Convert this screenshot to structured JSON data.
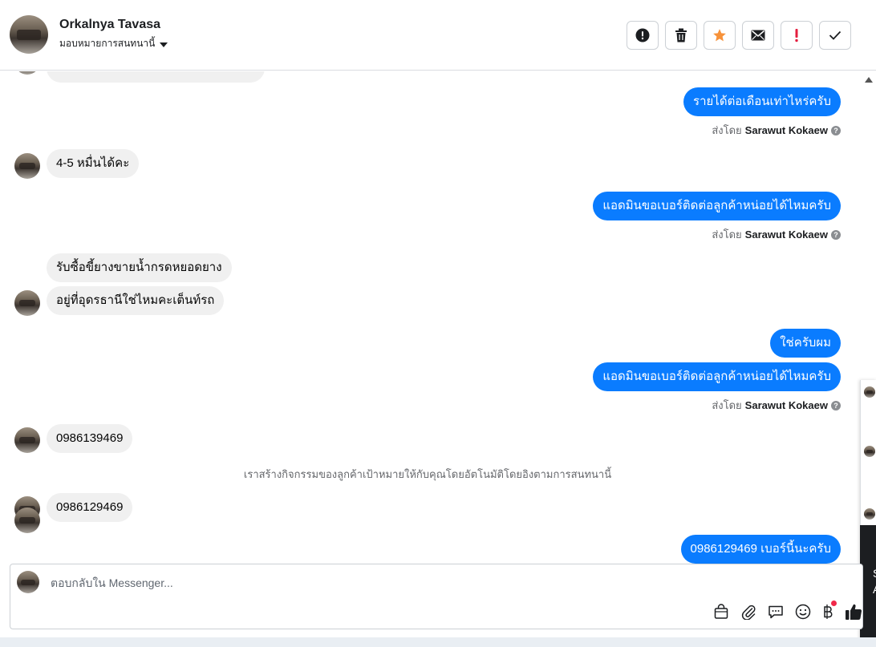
{
  "header": {
    "contact_name": "Orkalnya Tavasa",
    "assign_label": "มอบหมายการสนทนานี้"
  },
  "toolbar": {
    "buttons": [
      {
        "name": "report",
        "icon": "exclamation-circle-icon"
      },
      {
        "name": "delete",
        "icon": "trash-icon"
      },
      {
        "name": "star",
        "icon": "star-icon",
        "color": "#f7923a"
      },
      {
        "name": "mark-unread",
        "icon": "envelope-icon"
      },
      {
        "name": "mark-spam",
        "icon": "exclamation-icon",
        "color": "#e41e3f"
      },
      {
        "name": "mark-done",
        "icon": "checkmark-icon"
      }
    ]
  },
  "messages": {
    "m1": "รายได้ต่อเดือนเท่าไหร่ครับ",
    "m2": "4-5 หมื่นได้คะ",
    "m3": "แอดมินขอเบอร์ติดต่อลูกค้าหน่อยได้ไหมครับ",
    "m4": "รับซื้อขี้ยางขายน้ำกรดหยอดยาง",
    "m5": "อยู่ที่อุดรธานีใช่ไหมคะเต็นท์รถ",
    "m6": "ใช่ครับผม",
    "m7": "แอดมินขอเบอร์ติดต่อลูกค้าหน่อยได้ไหมครับ",
    "m8": "0986139469",
    "m9": "0986129469",
    "m10": "0986129469 เบอร์นี้นะครับ"
  },
  "sent_by": {
    "prefix": "ส่งโดย",
    "agent": "Sarawut Kokaew"
  },
  "notice": "เราสร้างกิจกรรมของลูกค้าเป้าหมายให้กับคุณโดยอัตโนมัติโดยอิงตามการสนทนานี้",
  "composer": {
    "placeholder": "ตอบกลับใน Messenger..."
  },
  "colors": {
    "outgoing_bubble": "#0a7cff",
    "incoming_bubble": "#f0f0f0",
    "star": "#f7923a",
    "alert": "#e41e3f"
  },
  "side_panel": {
    "text_lines": [
      "S",
      "A"
    ]
  }
}
